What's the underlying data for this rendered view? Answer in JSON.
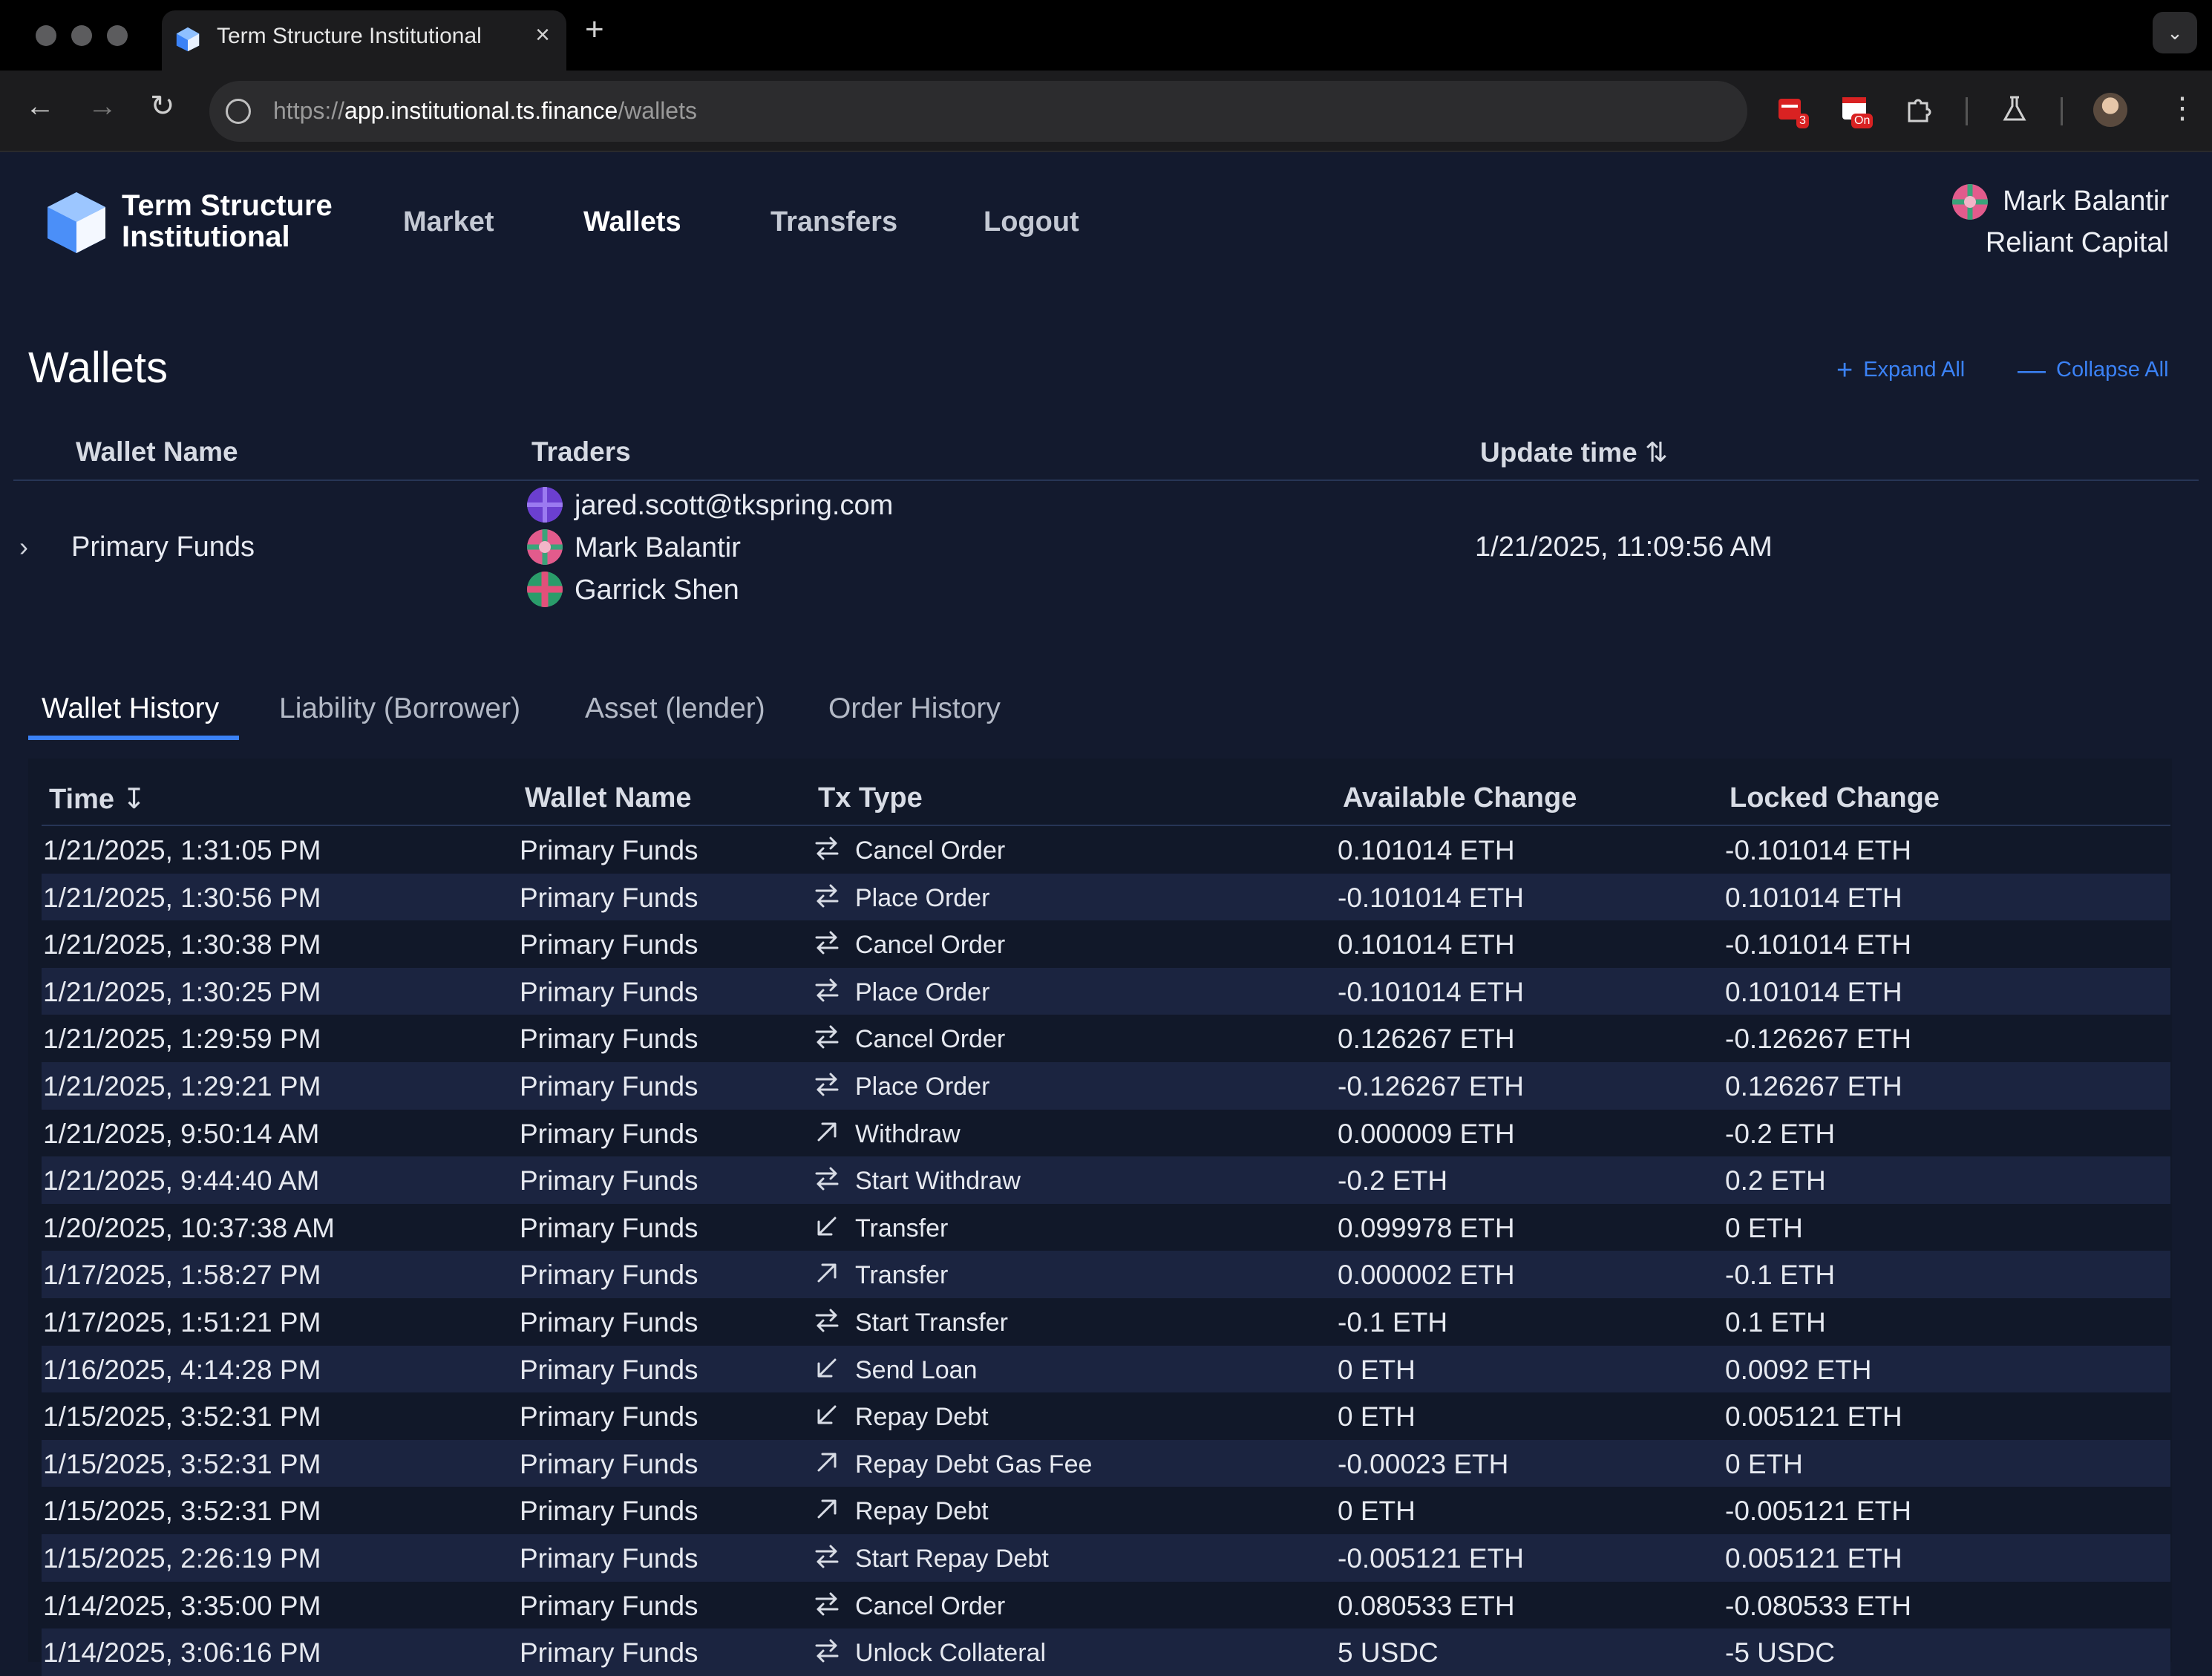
{
  "browser": {
    "tab_title": "Term Structure Institutional",
    "tab_close": "×",
    "new_tab": "+",
    "url_scheme": "https://",
    "url_host": "app.institutional.ts.finance",
    "url_path": "/wallets",
    "extensions": [
      {
        "name": "calendar-extension-icon",
        "badge": "3"
      },
      {
        "name": "record-extension-icon",
        "badge": "On"
      },
      {
        "name": "puzzle-extensions-icon",
        "badge": ""
      },
      {
        "name": "labs-flask-icon",
        "badge": ""
      }
    ]
  },
  "header": {
    "brand_line1": "Term Structure",
    "brand_line2": "Institutional",
    "nav": [
      {
        "label": "Market",
        "active": false
      },
      {
        "label": "Wallets",
        "active": true
      },
      {
        "label": "Transfers",
        "active": false
      },
      {
        "label": "Logout",
        "active": false
      }
    ],
    "user_name": "Mark Balantir",
    "user_org": "Reliant Capital"
  },
  "wallets": {
    "title": "Wallets",
    "expand_all": "Expand All",
    "collapse_all": "Collapse All",
    "columns": {
      "wallet_name": "Wallet Name",
      "traders": "Traders",
      "update_time": "Update time"
    },
    "row": {
      "name": "Primary Funds",
      "traders": [
        "jared.scott@tkspring.com",
        "Mark Balantir",
        "Garrick Shen"
      ],
      "update_time": "1/21/2025, 11:09:56 AM"
    }
  },
  "tabs": [
    "Wallet History",
    "Liability (Borrower)",
    "Asset (lender)",
    "Order History"
  ],
  "history": {
    "columns": [
      "Time",
      "Wallet Name",
      "Tx Type",
      "Available Change",
      "Locked Change"
    ],
    "rows": [
      [
        "1/21/2025, 1:31:05 PM",
        "Primary Funds",
        "swap",
        "Cancel Order",
        "0.101014 ETH",
        "-0.101014 ETH"
      ],
      [
        "1/21/2025, 1:30:56 PM",
        "Primary Funds",
        "swap",
        "Place Order",
        "-0.101014 ETH",
        "0.101014 ETH"
      ],
      [
        "1/21/2025, 1:30:38 PM",
        "Primary Funds",
        "swap",
        "Cancel Order",
        "0.101014 ETH",
        "-0.101014 ETH"
      ],
      [
        "1/21/2025, 1:30:25 PM",
        "Primary Funds",
        "swap",
        "Place Order",
        "-0.101014 ETH",
        "0.101014 ETH"
      ],
      [
        "1/21/2025, 1:29:59 PM",
        "Primary Funds",
        "swap",
        "Cancel Order",
        "0.126267 ETH",
        "-0.126267 ETH"
      ],
      [
        "1/21/2025, 1:29:21 PM",
        "Primary Funds",
        "swap",
        "Place Order",
        "-0.126267 ETH",
        "0.126267 ETH"
      ],
      [
        "1/21/2025, 9:50:14 AM",
        "Primary Funds",
        "out",
        "Withdraw",
        "0.000009 ETH",
        "-0.2 ETH"
      ],
      [
        "1/21/2025, 9:44:40 AM",
        "Primary Funds",
        "swap",
        "Start Withdraw",
        "-0.2 ETH",
        "0.2 ETH"
      ],
      [
        "1/20/2025, 10:37:38 AM",
        "Primary Funds",
        "in",
        "Transfer",
        "0.099978 ETH",
        "0 ETH"
      ],
      [
        "1/17/2025, 1:58:27 PM",
        "Primary Funds",
        "out",
        "Transfer",
        "0.000002 ETH",
        "-0.1 ETH"
      ],
      [
        "1/17/2025, 1:51:21 PM",
        "Primary Funds",
        "swap",
        "Start Transfer",
        "-0.1 ETH",
        "0.1 ETH"
      ],
      [
        "1/16/2025, 4:14:28 PM",
        "Primary Funds",
        "in",
        "Send Loan",
        "0 ETH",
        "0.0092 ETH"
      ],
      [
        "1/15/2025, 3:52:31 PM",
        "Primary Funds",
        "in",
        "Repay Debt",
        "0 ETH",
        "0.005121 ETH"
      ],
      [
        "1/15/2025, 3:52:31 PM",
        "Primary Funds",
        "out",
        "Repay Debt Gas Fee",
        "-0.00023 ETH",
        "0 ETH"
      ],
      [
        "1/15/2025, 3:52:31 PM",
        "Primary Funds",
        "out",
        "Repay Debt",
        "0 ETH",
        "-0.005121 ETH"
      ],
      [
        "1/15/2025, 2:26:19 PM",
        "Primary Funds",
        "swap",
        "Start Repay Debt",
        "-0.005121 ETH",
        "0.005121 ETH"
      ],
      [
        "1/14/2025, 3:35:00 PM",
        "Primary Funds",
        "swap",
        "Cancel Order",
        "0.080533 ETH",
        "-0.080533 ETH"
      ],
      [
        "1/14/2025, 3:06:16 PM",
        "Primary Funds",
        "swap",
        "Unlock Collateral",
        "5 USDC",
        "-5 USDC"
      ]
    ]
  },
  "colors": {
    "accent": "#3b82f6",
    "background": "#131a2e",
    "row_alt": "#1b2440"
  }
}
